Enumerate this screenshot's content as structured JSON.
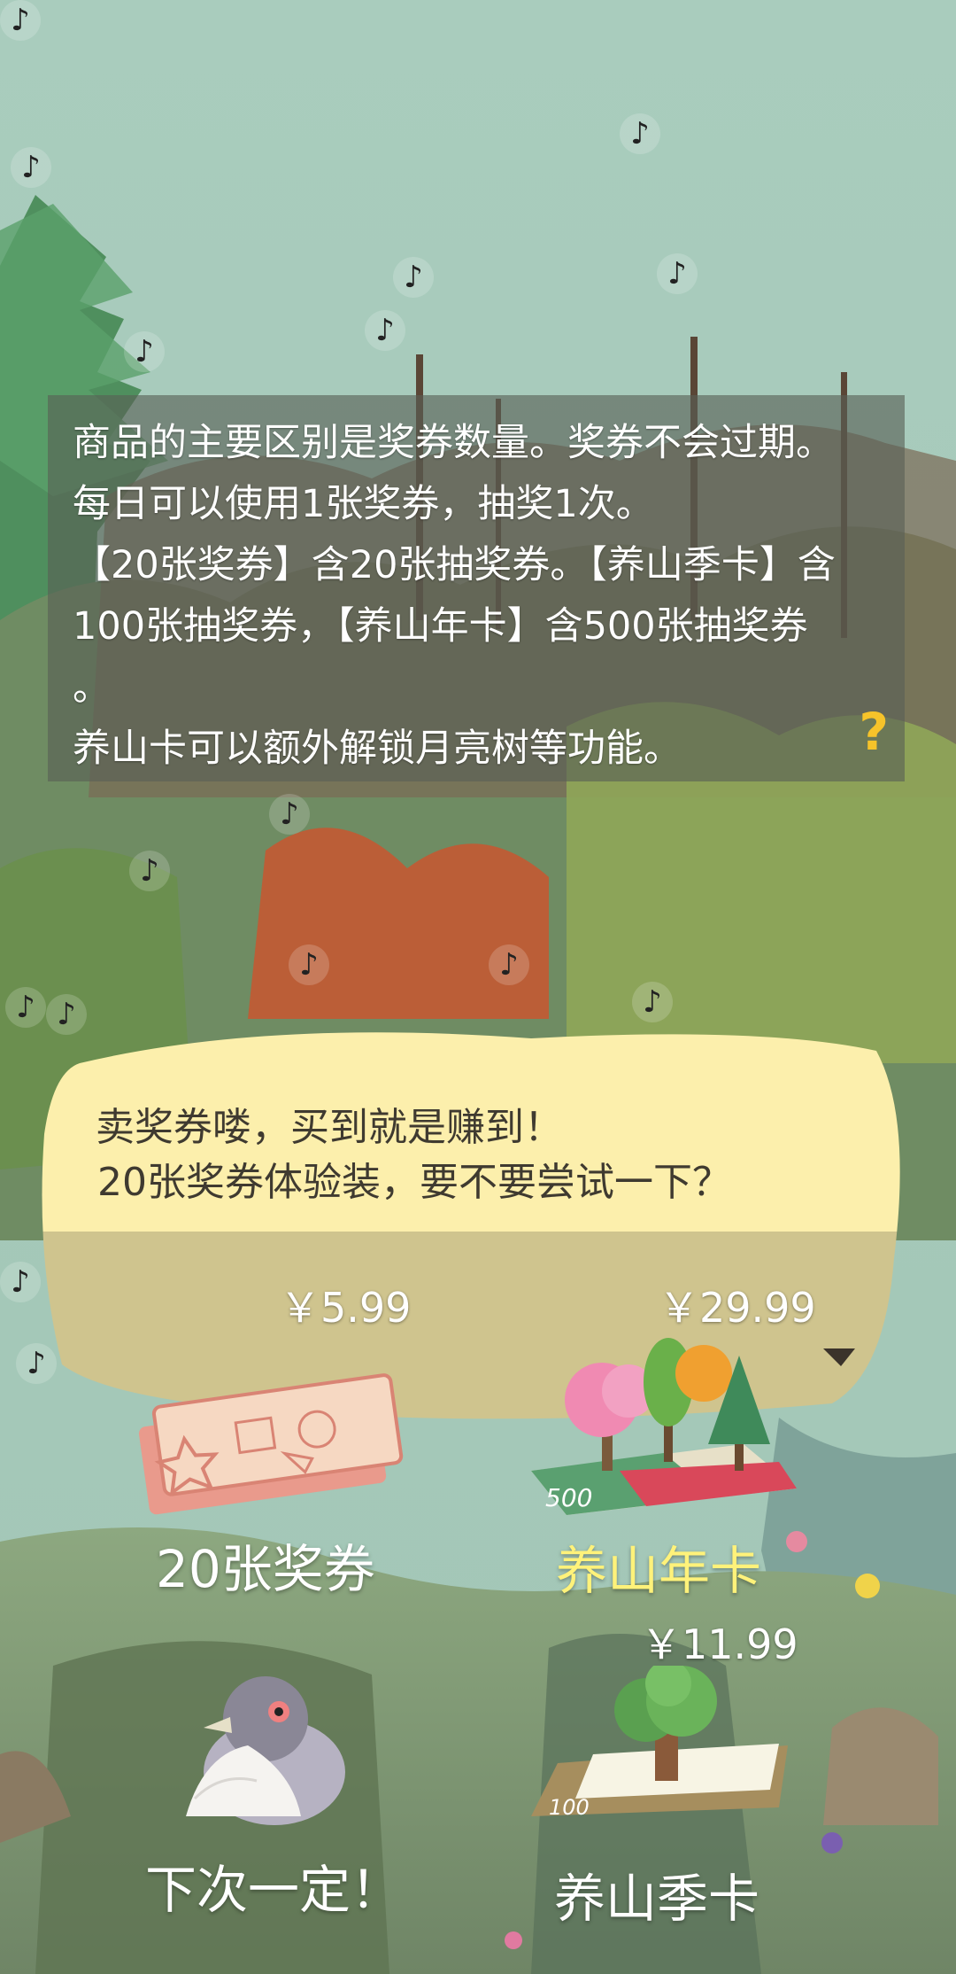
{
  "info": {
    "lines": [
      "商品的主要区别是奖券数量。奖券不会过期。",
      "每日可以使用1张奖券，抽奖1次。",
      "【20张奖券】含20张抽奖券。【养山季卡】含",
      "100张抽奖券，【养山年卡】含500张抽奖券",
      "。",
      "养山卡可以额外解锁月亮树等功能。"
    ],
    "help": "?"
  },
  "speech": {
    "line1": "卖奖券喽，买到就是赚到！",
    "line2": "20张奖券体验装，要不要尝试一下？"
  },
  "items": {
    "tickets": {
      "price": "￥5.99",
      "label": "20张奖券",
      "icon": "tickets-icon"
    },
    "year_card": {
      "price": "￥29.99",
      "label": "养山年卡",
      "card_number": "500",
      "icon": "year-card-icon"
    },
    "season_card": {
      "price": "￥11.99",
      "label": "养山季卡",
      "card_number": "100",
      "icon": "season-card-icon"
    },
    "next_time": {
      "label": "下次一定！",
      "icon": "pigeon-icon"
    }
  },
  "colors": {
    "info_text": "#ffffff",
    "help_accent": "#f6c32a",
    "label_white": "#ffffff",
    "label_highlight": "#fff27a",
    "bubble_top": "#fcefac",
    "bubble_bottom": "#cfc48e",
    "sky": "#a8cbbb"
  },
  "music_note": "♪"
}
